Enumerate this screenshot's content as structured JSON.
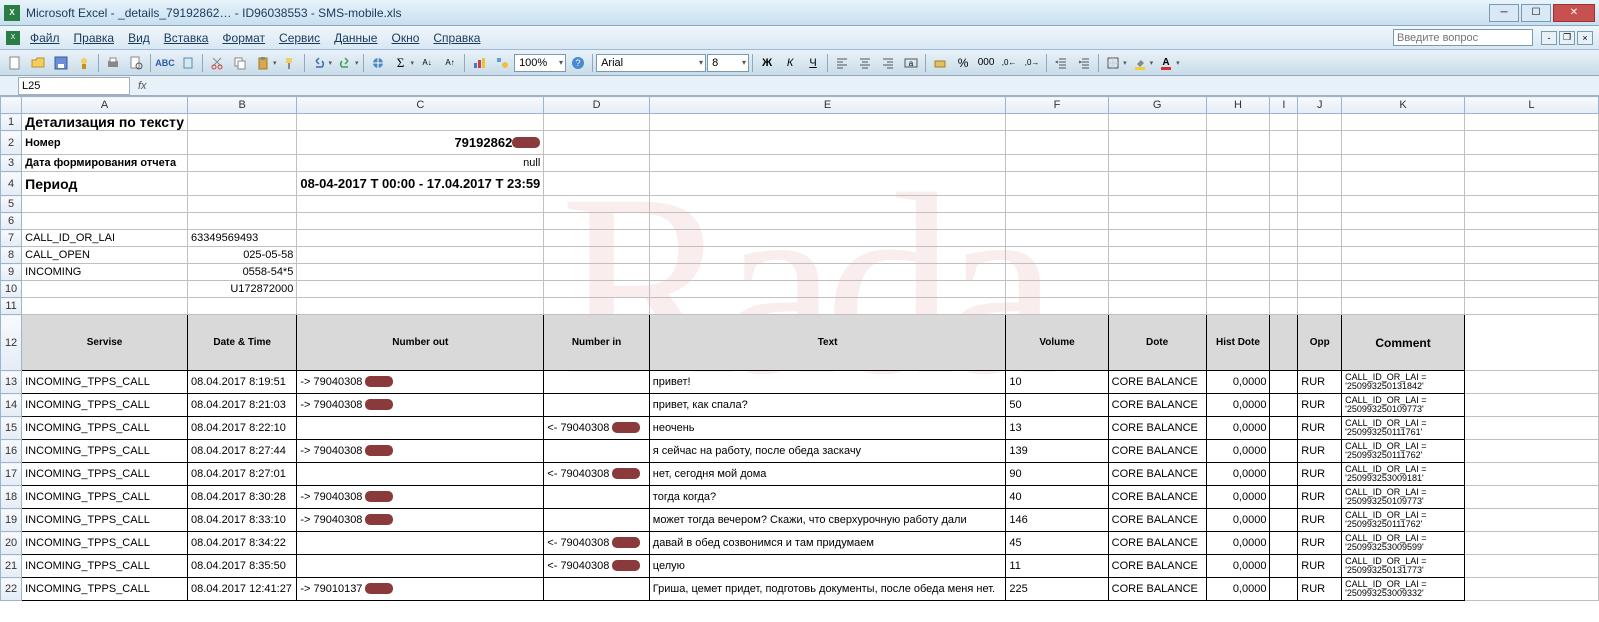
{
  "window": {
    "title": "Microsoft Excel - _details_79192862… - ID96038553 - SMS-mobile.xls"
  },
  "menu": {
    "file": "Файл",
    "edit": "Правка",
    "view": "Вид",
    "insert": "Вставка",
    "format": "Формат",
    "tools": "Сервис",
    "data": "Данные",
    "window": "Окно",
    "help": "Справка",
    "ask_placeholder": "Введите вопрос"
  },
  "toolbar": {
    "zoom": "100%",
    "font": "Arial",
    "size": "8"
  },
  "namebox": "L25",
  "columns": [
    "A",
    "B",
    "C",
    "D",
    "E",
    "F",
    "G",
    "H",
    "I",
    "J",
    "K",
    "L"
  ],
  "upper": {
    "title": "Детализация по тексту",
    "number_label": "Номер",
    "number_value_prefix": "79192862",
    "report_date_label": "Дата формирования отчета",
    "report_date_value": "null",
    "period_label": "Период",
    "period_value": "08-04-2017 T 00:00 - 17.04.2017 T 23:59",
    "k7": "CALL_ID_OR_LAI",
    "v7": "63349569493",
    "k8": "CALL_OPEN",
    "v8": "025-05-58",
    "k9": "INCOMING",
    "v9": "0558-54*5",
    "v10": "U172872000"
  },
  "headers": {
    "servise": "Servise",
    "datetime": "Date & Time",
    "numout": "Number out",
    "numin": "Number in",
    "text": "Text",
    "volume": "Volume",
    "dote": "Dote",
    "histdote": "Hist Dote",
    "opp": "Opp",
    "comment": "Comment"
  },
  "rows": [
    {
      "rn": "13",
      "svc": "INCOMING_TPPS_CALL",
      "dt": "08.04.2017 8:19:51",
      "out": "-> 79040308",
      "in": "",
      "txt": "привет!",
      "vol": "10",
      "dote": "CORE BALANCE",
      "hist": "0,0000",
      "opp": "RUR",
      "cmt": "CALL_ID_OR_LAI = '250993250131842'"
    },
    {
      "rn": "14",
      "svc": "INCOMING_TPPS_CALL",
      "dt": "08.04.2017 8:21:03",
      "out": "-> 79040308",
      "in": "",
      "txt": "привет, как спала?",
      "vol": "50",
      "dote": "CORE BALANCE",
      "hist": "0,0000",
      "opp": "RUR",
      "cmt": "CALL_ID_OR_LAI = '250993250109773'"
    },
    {
      "rn": "15",
      "svc": "INCOMING_TPPS_CALL",
      "dt": "08.04.2017 8:22:10",
      "out": "",
      "in": "<- 79040308",
      "txt": "неочень",
      "vol": "13",
      "dote": "CORE BALANCE",
      "hist": "0,0000",
      "opp": "RUR",
      "cmt": "CALL_ID_OR_LAI = '250993250111761'"
    },
    {
      "rn": "16",
      "svc": "INCOMING_TPPS_CALL",
      "dt": "08.04.2017 8:27:44",
      "out": "-> 79040308",
      "in": "",
      "txt": "я сейчас на работу, после обеда заскачу",
      "vol": "139",
      "dote": "CORE BALANCE",
      "hist": "0,0000",
      "opp": "RUR",
      "cmt": "CALL_ID_OR_LAI = '250993250111762'"
    },
    {
      "rn": "17",
      "svc": "INCOMING_TPPS_CALL",
      "dt": "08.04.2017 8:27:01",
      "out": "",
      "in": "<- 79040308",
      "txt": "нет, сегодня мой дома",
      "vol": "90",
      "dote": "CORE BALANCE",
      "hist": "0,0000",
      "opp": "RUR",
      "cmt": "CALL_ID_OR_LAI = '250993253009181'"
    },
    {
      "rn": "18",
      "svc": "INCOMING_TPPS_CALL",
      "dt": "08.04.2017 8:30:28",
      "out": "-> 79040308",
      "in": "",
      "txt": "тогда когда?",
      "vol": "40",
      "dote": "CORE BALANCE",
      "hist": "0,0000",
      "opp": "RUR",
      "cmt": "CALL_ID_OR_LAI = '250993250109773'"
    },
    {
      "rn": "19",
      "svc": "INCOMING_TPPS_CALL",
      "dt": "08.04.2017 8:33:10",
      "out": "-> 79040308",
      "in": "",
      "txt": " может тогда вечером? Скажи, что сверхурочную работу дали",
      "vol": "146",
      "dote": "CORE BALANCE",
      "hist": "0,0000",
      "opp": "RUR",
      "cmt": "CALL_ID_OR_LAI = '250993250111762'"
    },
    {
      "rn": "20",
      "svc": "INCOMING_TPPS_CALL",
      "dt": "08.04.2017 8:34:22",
      "out": "",
      "in": "<- 79040308",
      "txt": "давай в обед созвонимся и там придумаем",
      "vol": "45",
      "dote": "CORE BALANCE",
      "hist": "0,0000",
      "opp": "RUR",
      "cmt": "CALL_ID_OR_LAI = '250993253009599'"
    },
    {
      "rn": "21",
      "svc": "INCOMING_TPPS_CALL",
      "dt": "08.04.2017 8:35:50",
      "out": "",
      "in": "<- 79040308",
      "txt": "целую",
      "vol": "11",
      "dote": "CORE BALANCE",
      "hist": "0,0000",
      "opp": "RUR",
      "cmt": "CALL_ID_OR_LAI = '250993250131773'"
    },
    {
      "rn": "22",
      "svc": "INCOMING_TPPS_CALL",
      "dt": "08.04.2017 12:41:27",
      "out": "-> 79010137",
      "in": "",
      "txt": "Гриша, цемет придет, подготовь документы, после обеда меня нет.",
      "vol": "225",
      "dote": "CORE BALANCE",
      "hist": "0,0000",
      "opp": "RUR",
      "cmt": "CALL_ID_OR_LAI = '250993253009332'"
    }
  ]
}
